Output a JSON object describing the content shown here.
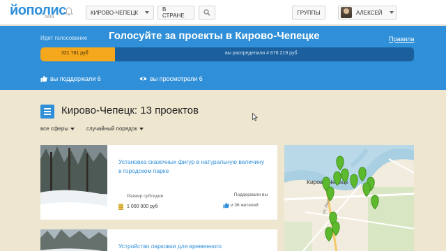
{
  "header": {
    "logo_text": "йополис",
    "logo_beta": "beta",
    "bell_icon": "bell-icon",
    "city_select": "КИРОВО-ЧЕПЕЦК",
    "country_button": "В СТРАНЕ",
    "search_icon": "search-icon",
    "groups_button": "ГРУППЫ",
    "user_name": "АЛЕКСЕЙ"
  },
  "vote": {
    "status": "Идет голосование",
    "title": "Голосуйте за проекты в Кирово-Чепецке",
    "rules_link": "Правила",
    "mine_amount": "321 781 руб",
    "mine_fraction": 0.2,
    "total_text": "вы распределили 4 678 219 руб",
    "supported": "вы поддержали 6",
    "viewed": "вы просмотрели 6"
  },
  "main": {
    "heading": "Кирово-Чепецк: 13 проектов",
    "filter_sphere": "все сферы",
    "filter_order": "случайный порядок"
  },
  "projects": [
    {
      "title": "Установка сказочных фигур в натуральную величину в городском парке",
      "subsidy_label": "Размер субсидии",
      "subsidy_amount": "1 000 000 руб",
      "support_label": "Поддержали вы",
      "support_count": "и 36 жителей"
    },
    {
      "title": "Устройство парковки для временного"
    }
  ],
  "map": {
    "city_label": "Кирово-Чепецк",
    "street_label": "ул. Ленина"
  },
  "colors": {
    "brand_blue": "#2f8fd8",
    "progress_orange": "#f5a81c",
    "progress_track": "#1b5f9c",
    "page_bg": "#efe6cf",
    "map_pin": "#5cb82c"
  }
}
